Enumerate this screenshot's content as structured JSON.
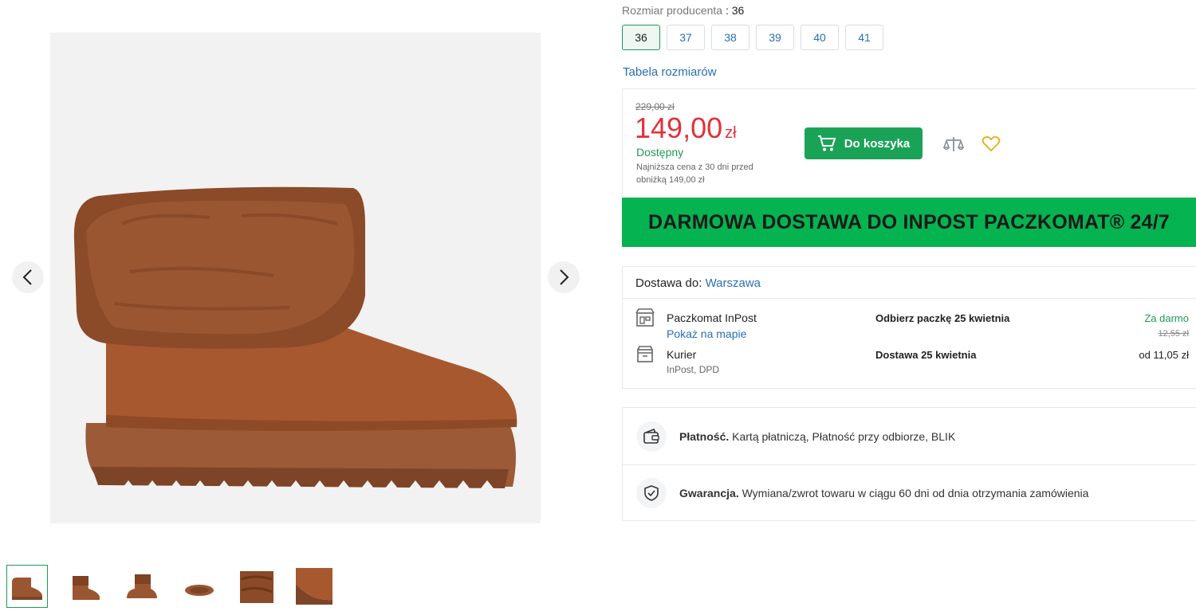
{
  "sizes": {
    "label": "Rozmiar producenta",
    "separator": ":",
    "selected": "36",
    "options": [
      "36",
      "37",
      "38",
      "39",
      "40",
      "41"
    ],
    "table_link": "Tabela rozmiarów"
  },
  "price": {
    "old": "229,00 zł",
    "current": "149,00",
    "currency": "zł",
    "availability": "Dostępny",
    "lowest_note": "Najniższa cena z 30 dni przed obniżką 149,00 zł",
    "add_to_cart": "Do koszyka"
  },
  "banner": {
    "text": "DARMOWA DOSTAWA DO INPOST PACZKOMAT® 24/7"
  },
  "delivery": {
    "label": "Dostawa do:",
    "city": "Warszawa",
    "options": [
      {
        "name": "Paczkomat InPost",
        "link": "Pokaż na mapie",
        "when": "Odbierz paczkę 25 kwietnia",
        "cost": "Za darmo",
        "cost_old": "12,55 zł"
      },
      {
        "name": "Kurier",
        "sub": "InPost, DPD",
        "when": "Dostawa 25 kwietnia",
        "cost": "od 11,05 zł"
      }
    ]
  },
  "info": {
    "payment_title": "Płatność.",
    "payment_text": "Kartą płatniczą, Płatność przy odbiorze, BLIK",
    "warranty_title": "Gwarancja.",
    "warranty_text": "Wymiana/zwrot towaru w ciągu 60 dni od dnia otrzymania zamówienia"
  },
  "colors": {
    "accent_green": "#1aa357",
    "banner_green": "#05b350",
    "price_red": "#e2313b",
    "link_blue": "#2a6fb1",
    "boot_brown": "#a0522d"
  },
  "icons": {
    "prev": "chevron-left-icon",
    "next": "chevron-right-icon",
    "cart": "cart-icon",
    "compare": "compare-icon",
    "favorite": "heart-icon",
    "locker": "parcel-locker-icon",
    "courier": "courier-box-icon",
    "payment": "wallet-icon",
    "warranty": "shield-check-icon"
  }
}
